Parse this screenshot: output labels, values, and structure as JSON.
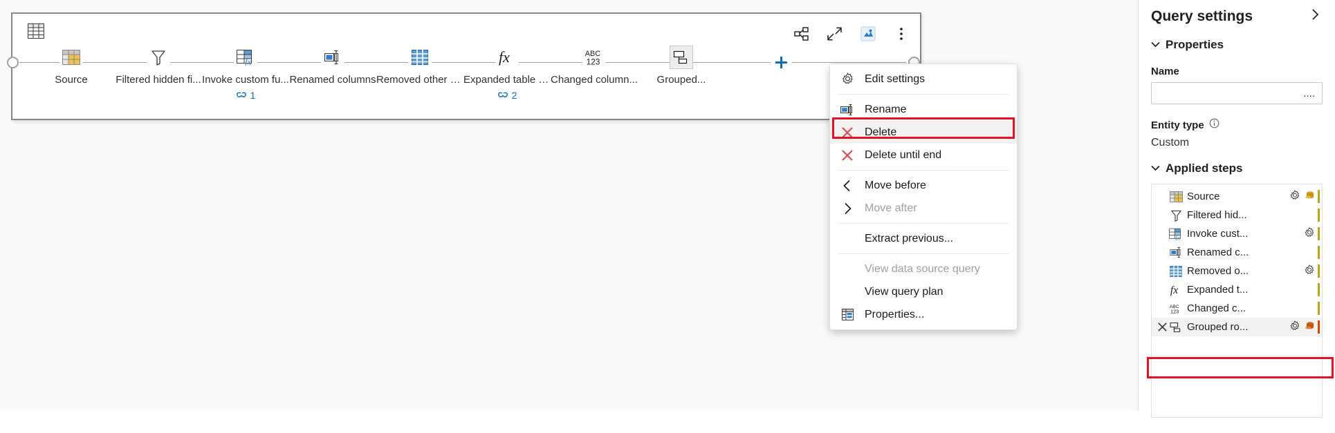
{
  "diagram": {
    "query_type_icon": "table-icon",
    "toolbar": [
      {
        "name": "share-icon",
        "label": "Share"
      },
      {
        "name": "collapse-diagonal-icon",
        "label": "Collapse"
      },
      {
        "name": "data-destination-icon",
        "label": "Data destination"
      },
      {
        "name": "more-options-icon",
        "label": "More options"
      }
    ],
    "add_step_label": "+",
    "steps": [
      {
        "icon": "source-table-icon",
        "label": "Source",
        "refs": null
      },
      {
        "icon": "filter-funnel-icon",
        "label": "Filtered hidden fi...",
        "refs": null
      },
      {
        "icon": "invoke-function-icon",
        "label": "Invoke custom fu...",
        "refs": "1"
      },
      {
        "icon": "rename-column-icon",
        "label": "Renamed columns",
        "refs": null
      },
      {
        "icon": "remove-columns-icon",
        "label": "Removed other c...",
        "refs": null
      },
      {
        "icon": "fx-icon",
        "label": "Expanded table c...",
        "refs": "2"
      },
      {
        "icon": "abc123-icon",
        "label": "Changed column...",
        "refs": null
      },
      {
        "icon": "group-by-icon",
        "label": "Grouped...",
        "refs": null,
        "selected": true
      }
    ]
  },
  "context_menu": {
    "items": [
      {
        "icon": "gear-icon",
        "label": "Edit settings",
        "disabled": false,
        "separator_after": true
      },
      {
        "icon": "rename-icon",
        "label": "Rename",
        "disabled": false
      },
      {
        "icon": "delete-x-icon",
        "label": "Delete",
        "disabled": false,
        "highlighted": true
      },
      {
        "icon": "delete-x-icon",
        "label": "Delete until end",
        "disabled": false,
        "separator_after": true
      },
      {
        "icon": "chevron-left-icon",
        "label": "Move before",
        "disabled": false
      },
      {
        "icon": "chevron-right-icon",
        "label": "Move after",
        "disabled": true,
        "separator_after": true
      },
      {
        "icon": null,
        "label": "Extract previous...",
        "disabled": false,
        "separator_after": true
      },
      {
        "icon": null,
        "label": "View data source query",
        "disabled": true
      },
      {
        "icon": null,
        "label": "View query plan",
        "disabled": false
      },
      {
        "icon": "properties-icon",
        "label": "Properties...",
        "disabled": false
      }
    ]
  },
  "query_settings": {
    "title": "Query settings",
    "collapse_icon": "chevron-right-icon",
    "properties": {
      "section_label": "Properties",
      "name_label": "Name",
      "name_value": "....",
      "entity_type_label": "Entity type",
      "entity_type_info_icon": "info-icon",
      "entity_type_value": "Custom"
    },
    "applied_steps": {
      "section_label": "Applied steps",
      "steps": [
        {
          "icon": "source-table-icon",
          "label": "Source",
          "gear": true,
          "db": "gold",
          "bar": "#b8a415"
        },
        {
          "icon": "filter-funnel-icon",
          "label": "Filtered hid...",
          "gear": false,
          "db": null,
          "bar": "#b8a415"
        },
        {
          "icon": "invoke-function-icon",
          "label": "Invoke cust...",
          "gear": true,
          "db": null,
          "bar": "#b8a415"
        },
        {
          "icon": "rename-column-icon",
          "label": "Renamed c...",
          "gear": false,
          "db": null,
          "bar": "#b8a415"
        },
        {
          "icon": "remove-columns-icon",
          "label": "Removed o...",
          "gear": true,
          "db": null,
          "bar": "#b8a415"
        },
        {
          "icon": "fx-icon",
          "label": "Expanded t...",
          "gear": false,
          "db": null,
          "bar": "#b8a415"
        },
        {
          "icon": "abc123-icon",
          "label": "Changed c...",
          "gear": false,
          "db": null,
          "bar": "#b8a415"
        },
        {
          "icon": "group-by-icon",
          "label": "Grouped ro...",
          "gear": true,
          "db": "orange",
          "bar": "#d04a02",
          "x": true,
          "selected": true
        }
      ]
    }
  },
  "colors": {
    "accent": "#0f6cbd",
    "highlight_red": "#e81123",
    "delete_x": "#d94a4a",
    "content_bg": "#faf9f8",
    "border": "#8a8886"
  }
}
